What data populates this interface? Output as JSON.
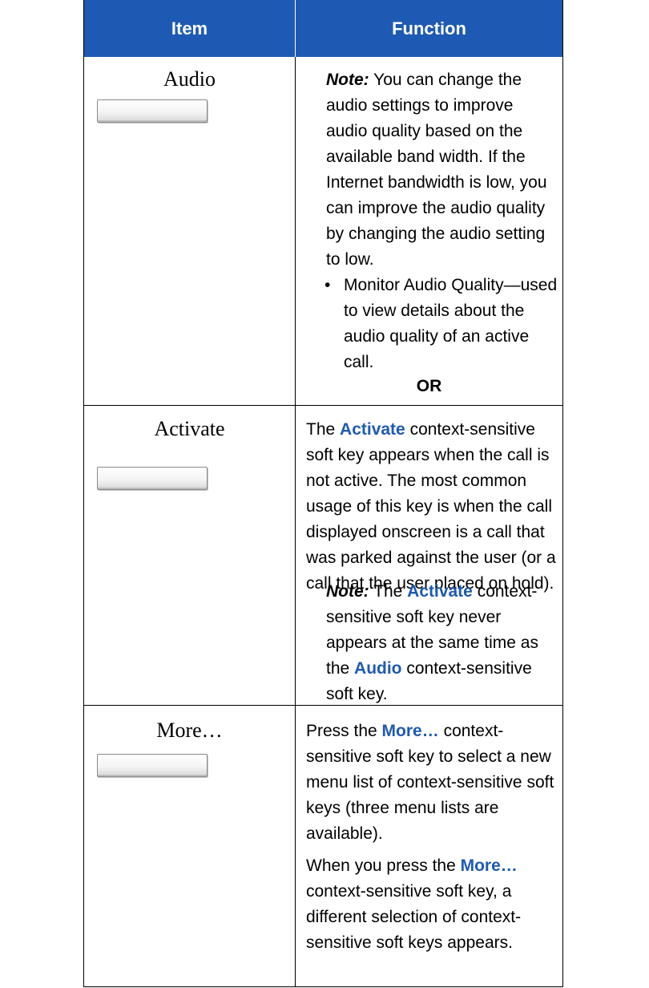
{
  "table": {
    "headers": {
      "item": "Item",
      "function": "Function"
    },
    "rows": [
      {
        "item": "Audio",
        "note_label": "Note:",
        "note_text": " You can change the audio settings to improve audio quality based on the available band width. If the Internet bandwidth is low, you can improve the audio quality by changing the audio setting to low.",
        "bullet_mark": "•",
        "bullet_text": "Monitor Audio Quality—used to view details about the audio quality of an active call.",
        "or_label": "OR"
      },
      {
        "item": "Activate",
        "p1_pre": "The ",
        "p1_key": "Activate",
        "p1_post": " context-sensitive soft key appears when the call is not active. The most common usage of this key is when the call displayed onscreen is a call that was parked against the user (or a call that the user placed on hold).",
        "note_label": "Note:",
        "note_pre": "  The ",
        "note_key1": "Activate",
        "note_mid": " context-sensitive soft key never appears at the same time as the ",
        "note_key2": "Audio",
        "note_post": " context-sensitive soft key."
      },
      {
        "item": "More…",
        "p1_pre": "Press the ",
        "p1_key": "More…",
        "p1_post": " context-sensitive soft key to select a new menu list of context-sensitive soft keys (three menu lists are available).",
        "p2_pre": "When you press the ",
        "p2_key": "More…",
        "p2_post": " context-sensitive soft key, a different selection of context-sensitive soft keys appears."
      }
    ]
  }
}
